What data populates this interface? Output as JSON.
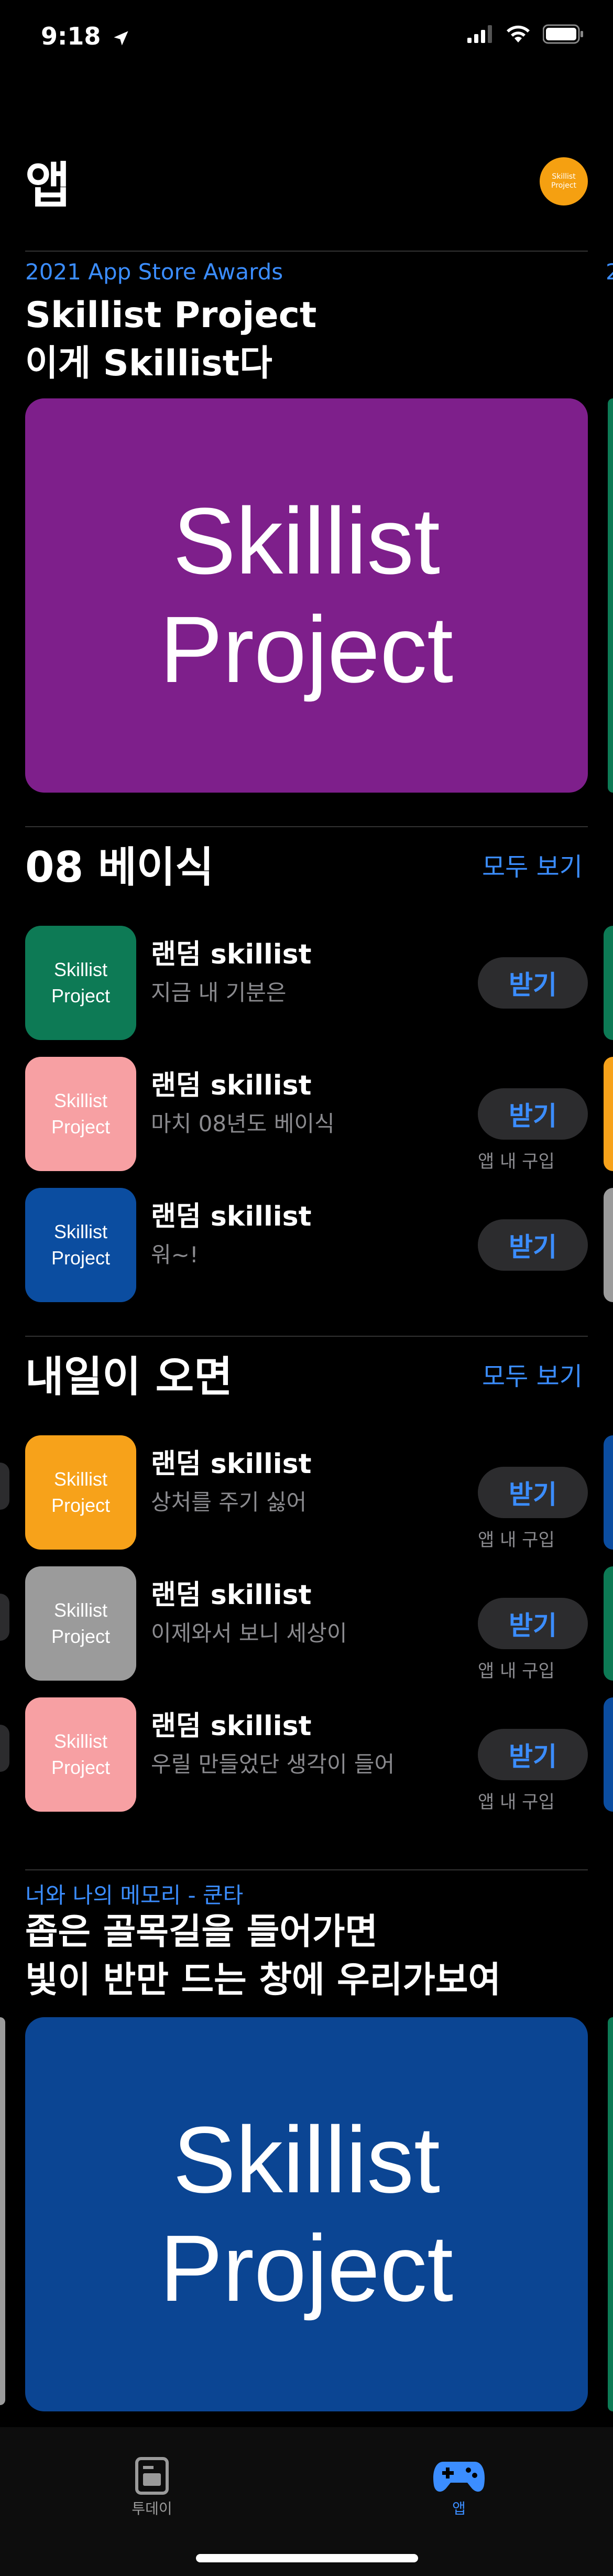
{
  "status": {
    "time": "9:18"
  },
  "header": {
    "title": "앱",
    "avatar_text": "Skillist Project"
  },
  "feature1": {
    "eyebrow": "2021 App Store Awards",
    "title_line1": "Skillist Project",
    "title_line2": "이게 Skillist다",
    "hero_line1": "Skillist",
    "hero_line2": "Project",
    "hero_color": "#7e1f8b",
    "next_eyebrow_peek": "2"
  },
  "section1": {
    "title": "08 베이식",
    "see_all": "모두 보기",
    "apps": [
      {
        "icon_line1": "Skillist",
        "icon_line2": "Project",
        "icon_color": "#0d7a55",
        "name": "랜덤 skillist",
        "subtitle": "지금 내 기분은",
        "button": "받기",
        "iap": ""
      },
      {
        "icon_line1": "Skillist",
        "icon_line2": "Project",
        "icon_color": "#f7a0a3",
        "name": "랜덤 skillist",
        "subtitle": "마치 08년도 베이식",
        "button": "받기",
        "iap": "앱 내 구입"
      },
      {
        "icon_line1": "Skillist",
        "icon_line2": "Project",
        "icon_color": "#0b4da0",
        "name": "랜덤 skillist",
        "subtitle": "워~!",
        "button": "받기",
        "iap": ""
      }
    ]
  },
  "section2": {
    "title": "내일이 오면",
    "see_all": "모두 보기",
    "apps": [
      {
        "icon_line1": "Skillist",
        "icon_line2": "Project",
        "icon_color": "#f7a21a",
        "name": "랜덤 skillist",
        "subtitle": "상처를 주기 싫어",
        "button": "받기",
        "iap": "앱 내 구입"
      },
      {
        "icon_line1": "Skillist",
        "icon_line2": "Project",
        "icon_color": "#9b9b9b",
        "name": "랜덤 skillist",
        "subtitle": "이제와서 보니 세상이",
        "button": "받기",
        "iap": "앱 내 구입"
      },
      {
        "icon_line1": "Skillist",
        "icon_line2": "Project",
        "icon_color": "#f7a0a3",
        "name": "랜덤 skillist",
        "subtitle": "우릴 만들었단 생각이 들어",
        "button": "받기",
        "iap": "앱 내 구입"
      }
    ]
  },
  "feature2": {
    "eyebrow": "너와 나의 메모리 - 쿤타",
    "title_line1": "좁은 골목길을 들어가면",
    "title_line2": "빛이 반만 드는 창에 우리가보여",
    "hero_line1": "Skillist",
    "hero_line2": "Project",
    "hero_color": "#0b4593"
  },
  "tabs": [
    {
      "label": "투데이",
      "icon": "today-icon",
      "active": false
    },
    {
      "label": "앱",
      "icon": "gamepad-icon",
      "active": true
    }
  ],
  "colors": {
    "accent": "#3b8dff",
    "background": "#000000"
  }
}
